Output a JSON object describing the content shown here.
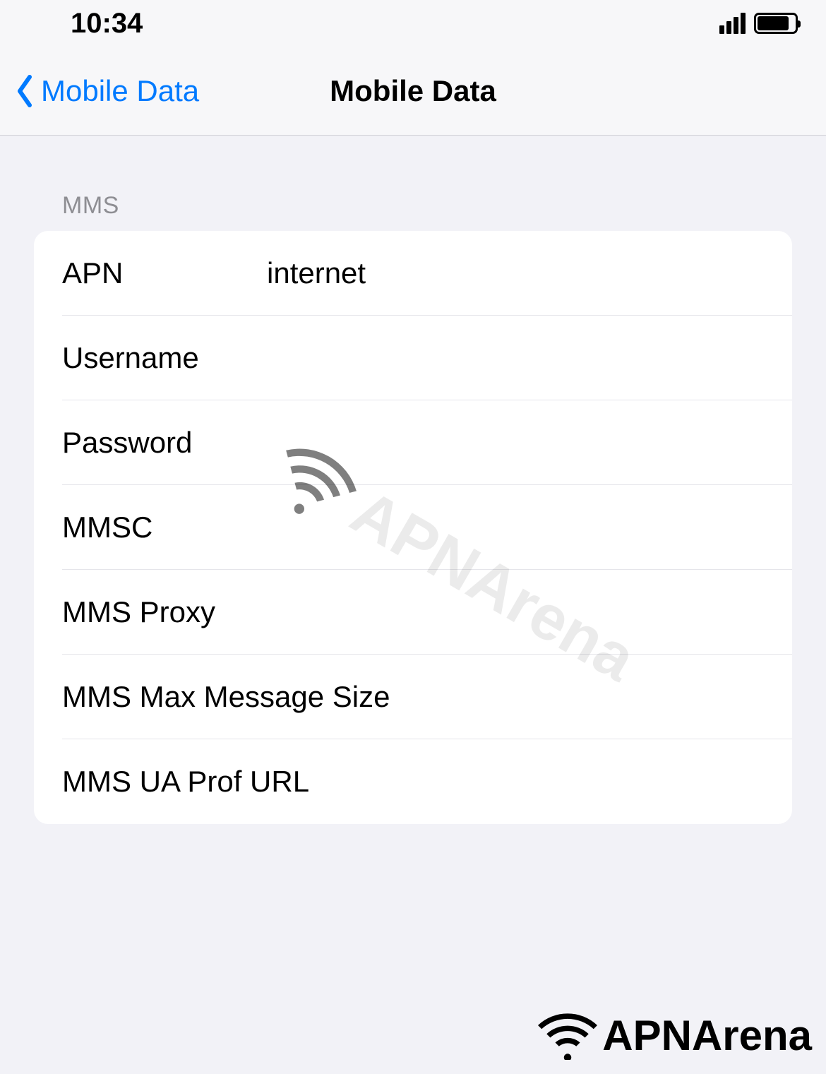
{
  "status_bar": {
    "time": "10:34"
  },
  "nav": {
    "back_label": "Mobile Data",
    "title": "Mobile Data"
  },
  "section": {
    "header": "MMS",
    "rows": [
      {
        "label": "APN",
        "value": "internet"
      },
      {
        "label": "Username",
        "value": ""
      },
      {
        "label": "Password",
        "value": ""
      },
      {
        "label": "MMSC",
        "value": ""
      },
      {
        "label": "MMS Proxy",
        "value": ""
      },
      {
        "label": "MMS Max Message Size",
        "value": ""
      },
      {
        "label": "MMS UA Prof URL",
        "value": ""
      }
    ]
  },
  "watermark": "APNArena",
  "footer_logo": "APNArena"
}
